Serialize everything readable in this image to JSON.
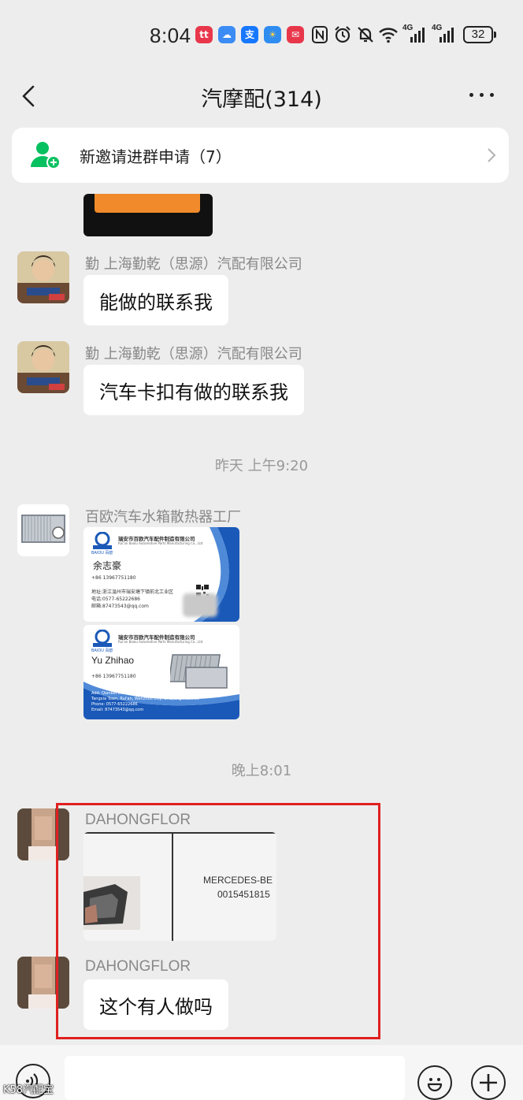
{
  "status_bar": {
    "time": "8:04",
    "app_icons": [
      "app-red-icon",
      "cloud-icon",
      "alipay-icon",
      "weather-icon",
      "mail-icon"
    ],
    "app_icon_labels": [
      "tt",
      "☁",
      "支",
      "☀",
      "✉"
    ],
    "system_icons": [
      "nfc-icon",
      "alarm-icon",
      "mute-icon",
      "wifi-icon",
      "signal-4g-icon",
      "signal-4g-icon"
    ],
    "signal1_label": "4G",
    "signal2_label": "4G",
    "battery": "32"
  },
  "nav": {
    "title": "汽摩配(314)"
  },
  "notice": {
    "text": "新邀请进群申请（7）"
  },
  "messages": [
    {
      "sender": "勤 上海勤乾（思源）汽配有限公司",
      "text": "能做的联系我"
    },
    {
      "sender": "勤 上海勤乾（思源）汽配有限公司",
      "text": "汽车卡扣有做的联系我"
    }
  ],
  "time_separators": [
    "昨天 上午9:20",
    "晚上8:01"
  ],
  "card_message": {
    "sender": "百欧汽车水箱散热器工厂",
    "card_front": {
      "company": "瑞安市百欧汽车配件制造有限公司",
      "company_en": "Rui'an Baiou Automotive Parts Manufacturing Co., Ltd",
      "logo_text": "BAIOU 百欧",
      "name": "余志豪",
      "phone": "+86 13967751180",
      "address": "地址:浙江温州市瑞安塘下镇前北工业区",
      "tel": "电话:0577-65222686",
      "email": "邮箱:87473543@qq.com"
    },
    "card_back": {
      "company": "瑞安市百欧汽车配件制造有限公司",
      "company_en": "Rui'an Baiou Automotive Parts Manufacturing Co., Ltd",
      "logo_text": "BAIOU 百欧",
      "name": "Yu Zhihao",
      "phone": "+86 13967751180",
      "address1": "Add: Qianbei Industrial Zone,",
      "address2": "Tangxia Town, Rui'an, Wenzhou City, Zhejiang Province",
      "tel": "Phone: 0577-65222686",
      "email": "Email: 87473543@qq.com"
    }
  },
  "dahong_messages": [
    {
      "sender": "DAHONGFLOR",
      "image_text1": "MERCEDES-BE",
      "image_text2": "0015451815"
    },
    {
      "sender": "DAHONGFLOR",
      "text": "这个有人做吗"
    }
  ],
  "watermark": "K58汽配宝",
  "colors": {
    "background": "#ededed",
    "bubble": "#ffffff",
    "highlight": "#e02020",
    "notice_icon": "#07c160"
  }
}
